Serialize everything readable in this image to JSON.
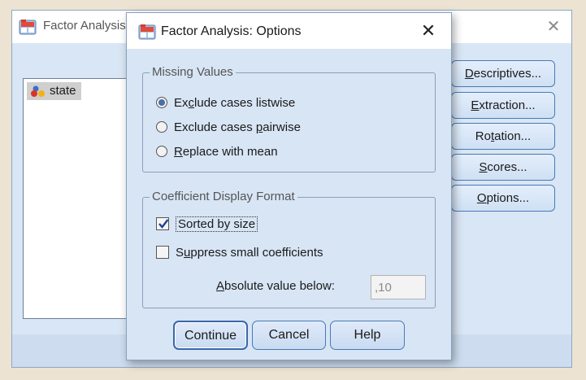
{
  "background_window": {
    "title": "Factor Analysis",
    "close_label": "✕",
    "variables": [
      {
        "label": "state",
        "icon": "nominal-variable-icon"
      }
    ],
    "buttons": [
      {
        "prefix": "",
        "mnemonic": "D",
        "suffix": "escriptives..."
      },
      {
        "prefix": "",
        "mnemonic": "E",
        "suffix": "xtraction..."
      },
      {
        "prefix": "Ro",
        "mnemonic": "t",
        "suffix": "ation..."
      },
      {
        "prefix": "",
        "mnemonic": "S",
        "suffix": "cores..."
      },
      {
        "prefix": "",
        "mnemonic": "O",
        "suffix": "ptions..."
      }
    ]
  },
  "dialog": {
    "title": "Factor Analysis: Options",
    "close_label": "✕",
    "missing_values": {
      "group_title": "Missing Values",
      "options": [
        {
          "prefix": "Ex",
          "mnemonic": "c",
          "suffix": "lude cases listwise",
          "selected": true
        },
        {
          "prefix": "Exclude cases ",
          "mnemonic": "p",
          "suffix": "airwise",
          "selected": false
        },
        {
          "prefix": "",
          "mnemonic": "R",
          "suffix": "eplace with mean",
          "selected": false
        }
      ]
    },
    "coefficient_format": {
      "group_title": "Coefficient Display Format",
      "sorted": {
        "label": "Sorted by size",
        "checked": true
      },
      "suppress": {
        "prefix": "S",
        "mnemonic": "u",
        "suffix": "ppress small coefficients",
        "checked": false
      },
      "absolute": {
        "mnemonic": "A",
        "suffix": "bsolute value below:",
        "value": ",10"
      }
    },
    "buttons": {
      "continue": "Continue",
      "cancel": "Cancel",
      "help": "Help"
    }
  },
  "colors": {
    "dialog_bg": "#d7e5f5",
    "button_border": "#4a7ab5",
    "radio_dot": "#4c6fa8",
    "check_mark": "#1f3f8f",
    "screen_bg": "#ece3d3"
  }
}
